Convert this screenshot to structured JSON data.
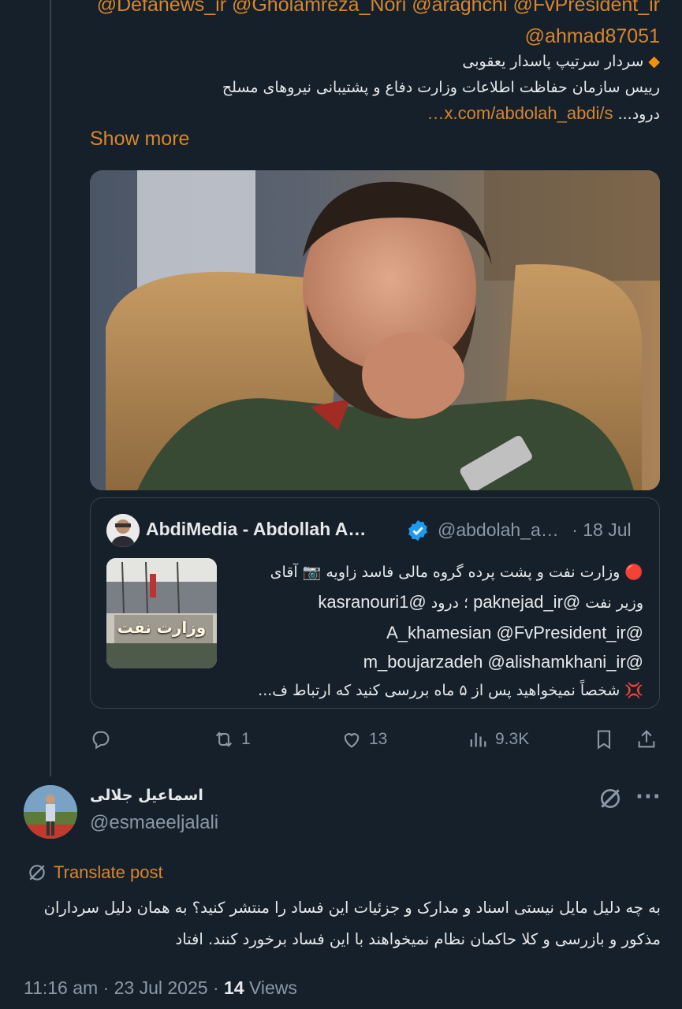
{
  "parent_post": {
    "mentions_line1": "@Defanews_ir @Gholamreza_Nori @araghchi @FvPresident_ir",
    "mentions_line2": "@ahmad87051",
    "line1": "سردار سرتیپ پاسدار یعقوبی",
    "line2": "رییس سازمان حفاظت اطلاعات وزارت دفاع و پشتیبانی نیروهای مسلح",
    "line3_text": "درود...",
    "line3_link": "x.com/abdolah_abdi/s…",
    "show_more": "Show more",
    "quote": {
      "name": "AbdiMedia - Abdollah A…",
      "handle": "@abdolah_a…",
      "date": "· 18 Jul",
      "thumb_sign": "وزارت نفت",
      "line1": "🔴 وزارت نفت و پشت پرده گروه مالی فاسد زاویه 📷 آقای",
      "line2_text": "وزیر نفت",
      "line2_m1": "@paknejad_ir",
      "line2_mid": "؛ درود",
      "line2_m2": "@kasranouri1",
      "line3": "@A_khamesian @FvPresident_ir",
      "line4": "@m_boujarzadeh @alishamkhani_ir",
      "line5": "💢 شخصاً نمیخواهید پس از ۵ ماه بررسی کنید که ارتباط ف..."
    },
    "actions": {
      "reposts": "1",
      "likes": "13",
      "views": "9.3K"
    }
  },
  "reply_post": {
    "name": "اسماعیل جلالی",
    "handle": "@esmaeeljalali",
    "translate": "Translate post",
    "text": "به چه دلیل مایل نیستی اسناد و مدارک و جزئیات این فساد را منتشر کنید؟ به همان دلیل سرداران مذکور و بازرسی و کلا حاکمان نظام نمیخواهند با این فساد برخورد کنند. افتاد",
    "time": "11:16 am · 23 Jul 2025 · ",
    "views_count": "14",
    "views_label": " Views"
  },
  "colors": {
    "background": "#15202b",
    "accent": "#d8862c",
    "muted": "#8b98a5",
    "verified": "#1d9bf0"
  }
}
